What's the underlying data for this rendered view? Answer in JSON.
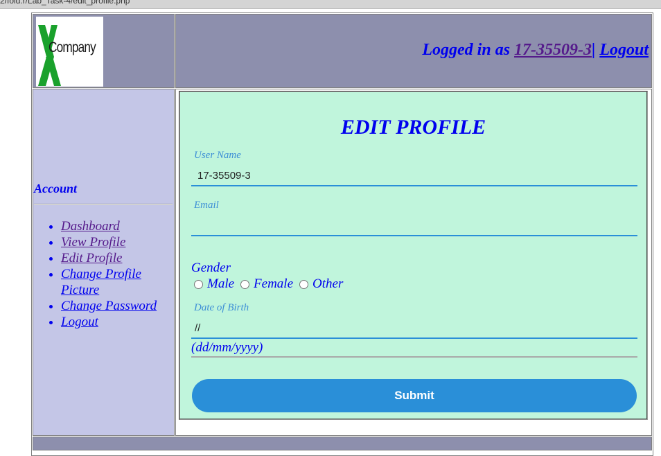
{
  "browser": {
    "url": "2/fold.r/Lab_Task-4/edit_profile.php"
  },
  "header": {
    "logo_text": "Company",
    "logo_letter": "X",
    "logged_in_prefix": "Logged in as ",
    "username_link": "17-35509-3",
    "separator": "|",
    "logout_link": "Logout"
  },
  "sidebar": {
    "heading": "Account",
    "items": [
      {
        "label": "Dashboard"
      },
      {
        "label": "View Profile"
      },
      {
        "label": "Edit Profile"
      },
      {
        "label": "Change Profile Picture"
      },
      {
        "label": "Change Password"
      },
      {
        "label": "Logout"
      }
    ]
  },
  "form": {
    "title": "EDIT PROFILE",
    "username_label": "User Name",
    "username_value": "17-35509-3",
    "email_label": "Email",
    "email_value": "",
    "gender_label": "Gender",
    "gender_options": [
      "Male",
      "Female",
      "Other"
    ],
    "dob_label": "Date of Birth",
    "dob_value": "//",
    "dob_hint": "(dd/mm/yyyy)",
    "submit_label": "Submit"
  },
  "colors": {
    "header_bg": "#8d8fad",
    "sidebar_bg": "#c4c6e7",
    "form_bg": "#c0f5dc",
    "accent_blue": "#2a8fd8",
    "link_blue": "#0000ee",
    "visited_purple": "#551a8b",
    "logo_green": "#1aa12c"
  }
}
